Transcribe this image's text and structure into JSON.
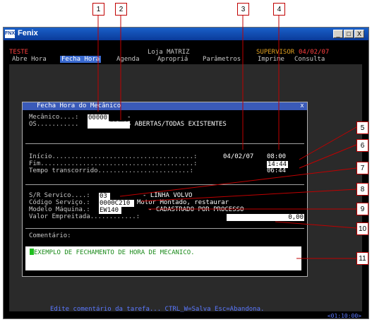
{
  "window": {
    "app_name": "Fenix",
    "logo": "FNX",
    "minimize_icon": "_",
    "maximize_icon": "□",
    "close_icon": "X"
  },
  "header": {
    "mode": "TESTE",
    "store": "Loja MATRIZ",
    "user": "SUPERVISOR",
    "date": "04/02/07"
  },
  "menu": [
    {
      "label": "Abre Hora",
      "active": false
    },
    {
      "label": "Fecha Hora",
      "active": true
    },
    {
      "label": "Agenda",
      "active": false
    },
    {
      "label": "Apropriá",
      "active": false
    },
    {
      "label": "Parâmetros",
      "active": false
    },
    {
      "label": "Imprime",
      "active": false
    },
    {
      "label": "Consulta",
      "active": false
    }
  ],
  "dialog": {
    "title": "Fecha Hora do Mecânico",
    "close_icon": "x",
    "mecanico_label": "Mecânico....:",
    "mecanico_value": "00000",
    "mecanico_name": "-",
    "os_label": "OS...........",
    "os_value": "TODAS AS ABERTAS/TODAS EXISTENTES",
    "inicio_label": "Início.....................................:",
    "inicio_date": "04/02/07",
    "inicio_time": "08:00",
    "fim_label": "Fim........................................:",
    "fim_time": "14:44",
    "tempo_label": "Tempo transcorrido........................:",
    "tempo_value": "06:44",
    "servico_label": "S/R Servico....:",
    "servico_value": "03",
    "servico_desc": "- LINHA VOLVO",
    "codigo_label": "Código Serviço.:",
    "codigo_value": "0000C210",
    "codigo_desc": "Motor Montado, restaurar",
    "modelo_label": "Modelo Máquina.:",
    "modelo_value": "EW140",
    "modelo_desc": "- CADASTRADO POR PROCESSO",
    "valor_label": "Valor Empreitada............:",
    "valor_value": "0,00",
    "comentario_label": "Comentário:",
    "comentario_value": "EXEMPLO DE FECHAMENTO DE HORA DE MECANICO."
  },
  "status": {
    "hint": "Edite comentário da tarefa... CTRL_W=Salva  Esc=Abandona.",
    "position": "<01:10:00>"
  },
  "callouts": [
    "1",
    "2",
    "3",
    "4",
    "5",
    "6",
    "7",
    "8",
    "9",
    "10",
    "11"
  ]
}
